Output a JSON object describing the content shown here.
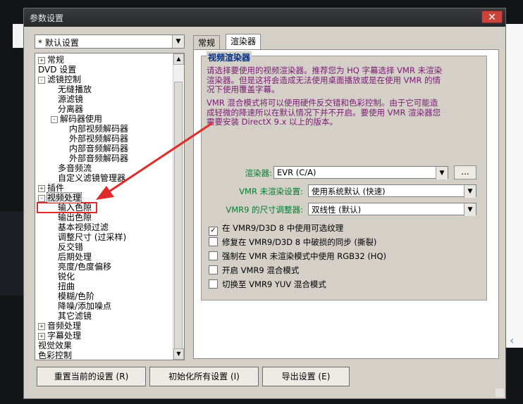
{
  "window": {
    "title": "参数设置",
    "close": "✕"
  },
  "preset": {
    "value": "* 默认设置"
  },
  "tree": {
    "items": [
      {
        "label": "常规",
        "exp": "+",
        "level": 0
      },
      {
        "label": "DVD 设置",
        "exp": "",
        "level": 0
      },
      {
        "label": "滤镜控制",
        "exp": "-",
        "level": 0
      },
      {
        "label": "无缝播放",
        "exp": "",
        "level": 2
      },
      {
        "label": "源滤镜",
        "exp": "",
        "level": 2
      },
      {
        "label": "分离器",
        "exp": "",
        "level": 2
      },
      {
        "label": "解码器使用",
        "exp": "-",
        "level": 1
      },
      {
        "label": "内部视频解码器",
        "exp": "",
        "level": 3
      },
      {
        "label": "外部视频解码器",
        "exp": "",
        "level": 3
      },
      {
        "label": "内部音频解码器",
        "exp": "",
        "level": 3
      },
      {
        "label": "外部音频解码器",
        "exp": "",
        "level": 3
      },
      {
        "label": "多音频流",
        "exp": "",
        "level": 2
      },
      {
        "label": "自定义滤镜管理器",
        "exp": "",
        "level": 2
      },
      {
        "label": "插件",
        "exp": "+",
        "level": 0
      },
      {
        "label": "视频处理",
        "exp": "-",
        "level": 0,
        "selected": true
      },
      {
        "label": "输入色隙",
        "exp": "",
        "level": 2
      },
      {
        "label": "输出色隙",
        "exp": "",
        "level": 2
      },
      {
        "label": "基本视频过滤",
        "exp": "",
        "level": 2
      },
      {
        "label": "调整尺寸 (过采样)",
        "exp": "",
        "level": 2
      },
      {
        "label": "反交错",
        "exp": "",
        "level": 2
      },
      {
        "label": "后期处理",
        "exp": "",
        "level": 2
      },
      {
        "label": "亮度/色度偏移",
        "exp": "",
        "level": 2
      },
      {
        "label": "锐化",
        "exp": "",
        "level": 2
      },
      {
        "label": "扭曲",
        "exp": "",
        "level": 2
      },
      {
        "label": "模糊/色阶",
        "exp": "",
        "level": 2
      },
      {
        "label": "降噪/添加噪点",
        "exp": "",
        "level": 2
      },
      {
        "label": "其它滤镜",
        "exp": "",
        "level": 2
      },
      {
        "label": "音频处理",
        "exp": "+",
        "level": 0
      },
      {
        "label": "字幕处理",
        "exp": "+",
        "level": 0
      },
      {
        "label": "视觉效果",
        "exp": "",
        "level": 0
      },
      {
        "label": "色彩控制",
        "exp": "",
        "level": 0
      }
    ]
  },
  "tabs": [
    {
      "label": "常规"
    },
    {
      "label": "渲染器"
    }
  ],
  "panel": {
    "group_title": "视频渲染器",
    "desc1": [
      "请选择要使用的视频渲染器。推荐您为 HQ 字幕选择 VMR 未渲染",
      "渲染器。但是这将会造成无法使用桌面播放或是在使用 VMR 的情",
      "况下使用覆盖字幕。"
    ],
    "desc2": [
      "VMR 混合模式将可以使用硬件反交错和色彩控制。由于它可能造",
      "成轻微的降速所以在默认情况下并不开启。要使用 VMR 渲染器您",
      "需要安装 DirectX 9.x 以上的版本。"
    ],
    "renderer_label": "渲染器:",
    "renderer_value": "EVR (C/A)",
    "more": "...",
    "vmr_label": "VMR 未渲染设置:",
    "vmr_value": "使用系统默认 (快速)",
    "vmr9_label": "VMR9 的尺寸调整器:",
    "vmr9_value": "双线性 (默认)",
    "checks": [
      {
        "label": "在 VMR9/D3D 8 中使用可选纹理",
        "checked": true
      },
      {
        "label": "修复在 VMR9/D3D 8 中破损的同步 (撕裂)",
        "checked": false
      },
      {
        "label": "强制在 VMR 未渲染模式中使用 RGB32 (HQ)",
        "checked": false
      },
      {
        "label": "开启 VMR9 混合模式",
        "checked": false
      },
      {
        "label": "切换至 VMR9 YUV 混合模式",
        "checked": false
      }
    ]
  },
  "buttons": {
    "reset": "重置当前的设置 (R)",
    "init": "初始化所有设置 (I)",
    "export": "导出设置 (E)"
  },
  "colors": {
    "accent_arrow": "#e12a2a",
    "group_title": "#002e88",
    "desc": "#7a1a74",
    "label": "#007f2e"
  }
}
